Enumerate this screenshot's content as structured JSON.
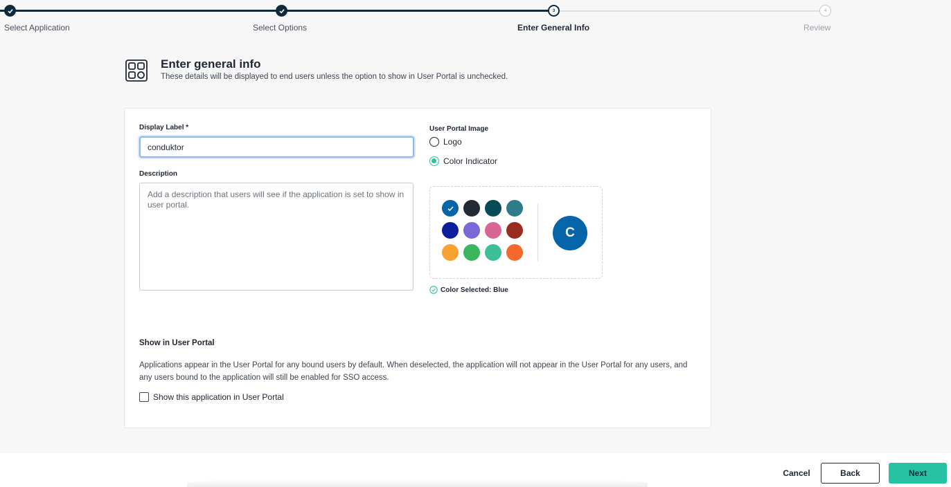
{
  "stepper": {
    "steps": [
      {
        "label": "Select Application",
        "state": "done"
      },
      {
        "label": "Select Options",
        "state": "done"
      },
      {
        "label": "Enter General Info",
        "state": "current",
        "number": "3"
      },
      {
        "label": "Review",
        "state": "future",
        "number": "4"
      }
    ]
  },
  "header": {
    "icon": "apps-grid-icon",
    "title": "Enter general info",
    "subtitle": "These details will be displayed to end users unless the option to show in User Portal is unchecked."
  },
  "form": {
    "display_label": {
      "label": "Display Label *",
      "value": "conduktor"
    },
    "description": {
      "label": "Description",
      "placeholder": "Add a description that users will see if the application is set to show in user portal.",
      "value": ""
    },
    "portal_image": {
      "label": "User Portal Image",
      "options": [
        {
          "label": "Logo",
          "selected": false
        },
        {
          "label": "Color Indicator",
          "selected": true
        }
      ],
      "colors": [
        "#0664a8",
        "#222b33",
        "#064b55",
        "#2e7b8a",
        "#0b1e9e",
        "#7a67d8",
        "#d96595",
        "#9a2d1f",
        "#f9a232",
        "#3cb55f",
        "#3cbf97",
        "#f4692b"
      ],
      "selected_color_index": 0,
      "preview_letter": "C",
      "status": "Color Selected: Blue"
    },
    "show_in_portal": {
      "title": "Show in User Portal",
      "description": "Applications appear in the User Portal for any bound users by default. When deselected, the application will not appear in the User Portal for any users, and any users bound to the application will still be enabled for SSO access.",
      "checkbox_label": "Show this application in User Portal",
      "checked": false
    }
  },
  "footer": {
    "cancel": "Cancel",
    "back": "Back",
    "next": "Next"
  },
  "colors": {
    "accent": "#27c2a4",
    "dark": "#0e2b3d"
  }
}
